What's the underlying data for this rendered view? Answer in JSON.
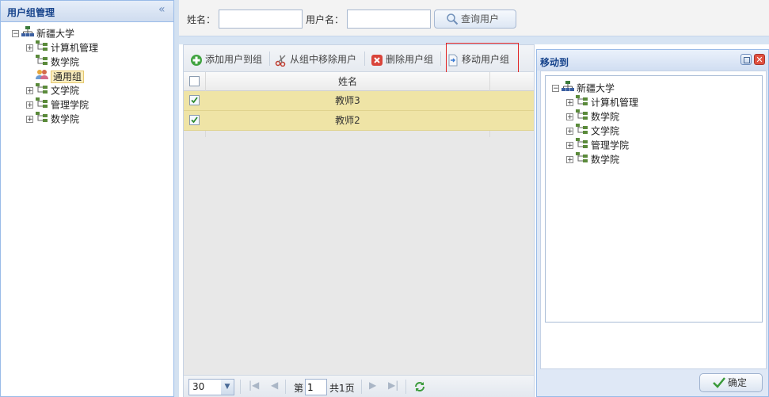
{
  "left_panel": {
    "title": "用户组管理",
    "tree": [
      {
        "label": "新疆大学",
        "icon": "org-tree-icon",
        "expander": "⊟",
        "level": 0
      },
      {
        "label": "计算机管理",
        "icon": "dept-icon",
        "expander": "⊞",
        "level": 1
      },
      {
        "label": "数学院",
        "icon": "dept-icon",
        "expander": "",
        "level": 1
      },
      {
        "label": "通用组",
        "icon": "user-group-icon",
        "expander": "",
        "level": 1,
        "selected": true
      },
      {
        "label": "文学院",
        "icon": "dept-icon",
        "expander": "⊞",
        "level": 1
      },
      {
        "label": "管理学院",
        "icon": "dept-icon",
        "expander": "⊞",
        "level": 1
      },
      {
        "label": "数学院",
        "icon": "dept-icon",
        "expander": "⊞",
        "level": 1
      }
    ]
  },
  "search": {
    "name_label": "姓名：",
    "name_value": "",
    "username_label": "用户名：",
    "username_value": "",
    "button_label": "查询用户"
  },
  "toolbar": {
    "add_label": "添加用户到组",
    "remove_label": "从组中移除用户",
    "delete_label": "删除用户组",
    "move_label": "移动用户组"
  },
  "grid": {
    "column_name": "姓名",
    "rows": [
      {
        "name": "教师3",
        "checked": true
      },
      {
        "name": "教师2",
        "checked": true
      }
    ]
  },
  "pager": {
    "page_size": "30",
    "page_prefix": "第",
    "page_value": "1",
    "page_total": "共1页"
  },
  "dialog": {
    "title": "移动到",
    "tree": [
      {
        "label": "新疆大学",
        "icon": "org-tree-icon",
        "expander": "⊟",
        "level": 0
      },
      {
        "label": "计算机管理",
        "icon": "dept-icon",
        "expander": "⊞",
        "level": 1
      },
      {
        "label": "数学院",
        "icon": "dept-icon",
        "expander": "⊞",
        "level": 1
      },
      {
        "label": "文学院",
        "icon": "dept-icon",
        "expander": "⊞",
        "level": 1
      },
      {
        "label": "管理学院",
        "icon": "dept-icon",
        "expander": "⊞",
        "level": 1
      },
      {
        "label": "数学院",
        "icon": "dept-icon",
        "expander": "⊞",
        "level": 1
      }
    ],
    "ok_label": "确定"
  },
  "colors": {
    "accent": "#15428b",
    "border": "#99bbe8",
    "row_selected": "#efe4a6",
    "highlight_box": "#e02020"
  }
}
